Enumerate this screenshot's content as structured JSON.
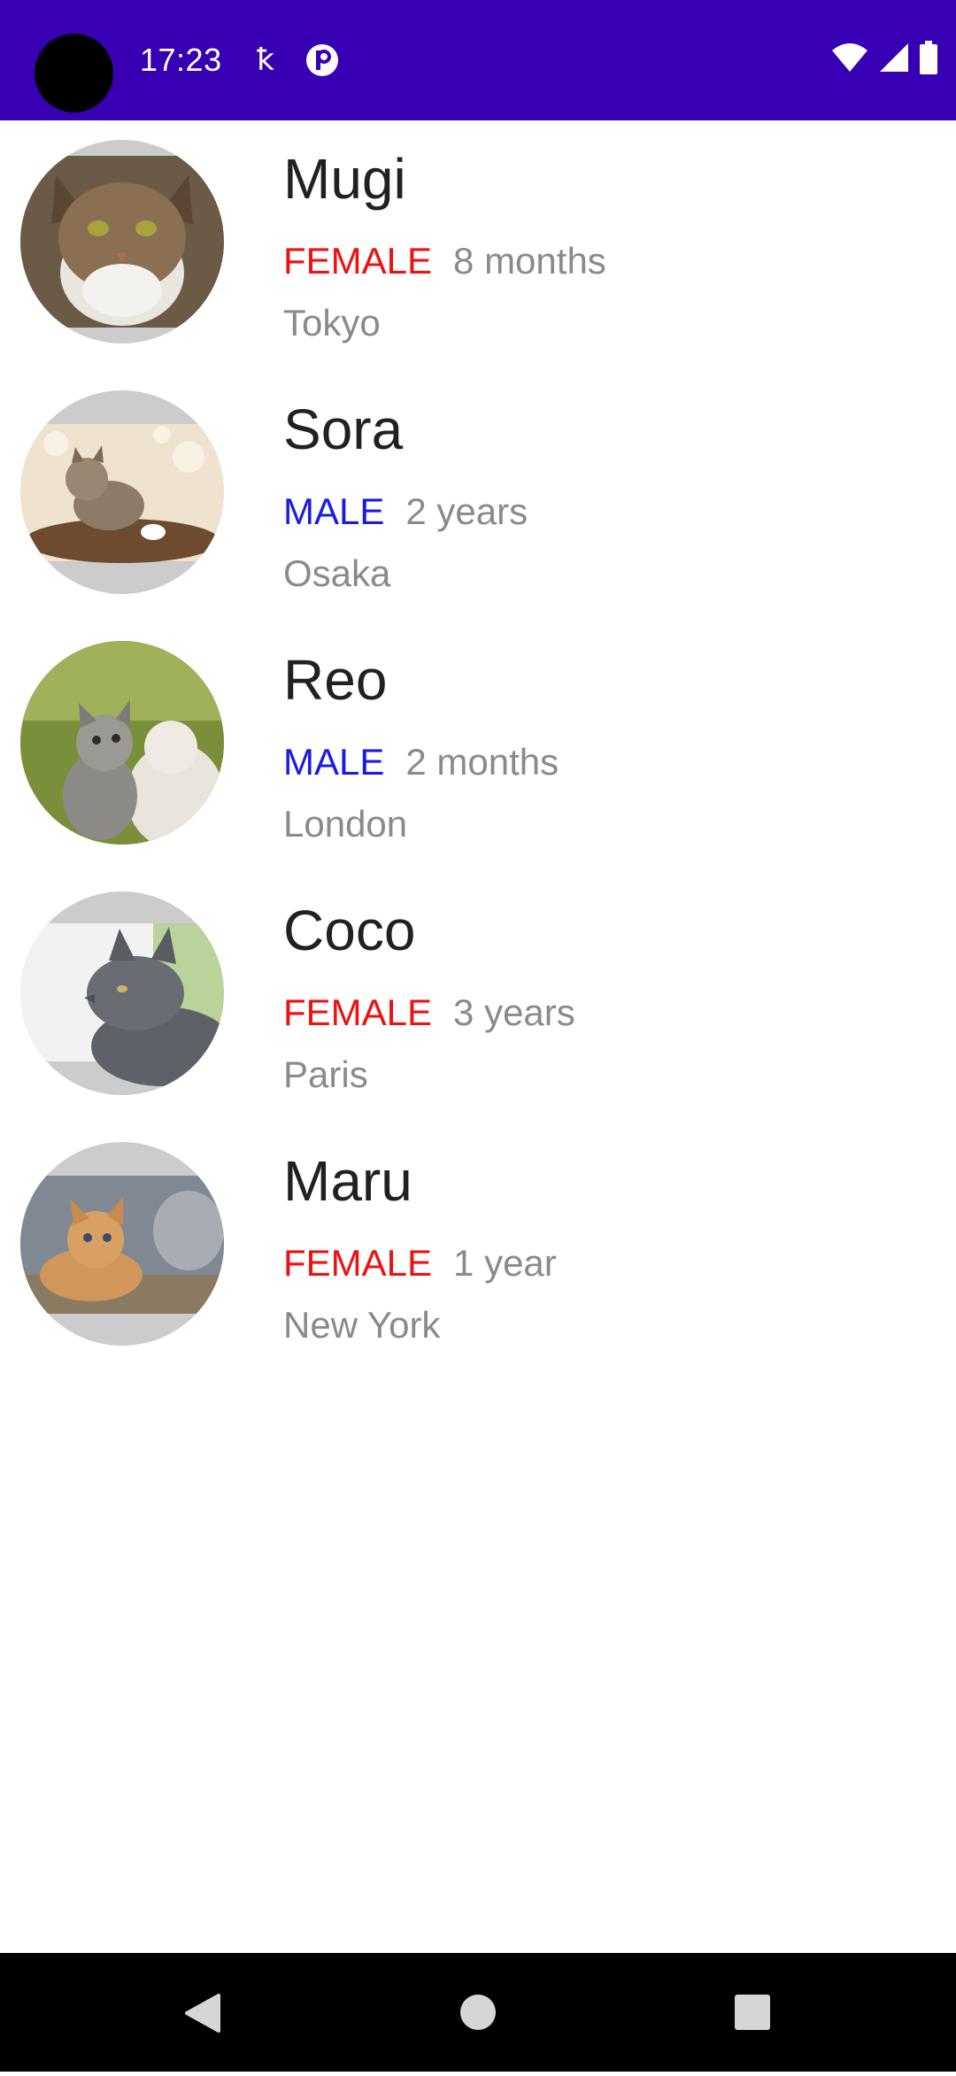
{
  "status_bar": {
    "time": "17:23",
    "icons": [
      "kotlin-icon",
      "app-notification-icon",
      "wifi-icon",
      "cellular-signal-icon",
      "battery-icon"
    ],
    "color": "#3700b3"
  },
  "cats": [
    {
      "name": "Mugi",
      "gender": "FEMALE",
      "age": "8 months",
      "city": "Tokyo"
    },
    {
      "name": "Sora",
      "gender": "MALE",
      "age": "2 years",
      "city": "Osaka"
    },
    {
      "name": "Reo",
      "gender": "MALE",
      "age": "2 months",
      "city": "London"
    },
    {
      "name": "Coco",
      "gender": "FEMALE",
      "age": "3 years",
      "city": "Paris"
    },
    {
      "name": "Maru",
      "gender": "FEMALE",
      "age": "1 year",
      "city": "New York"
    }
  ],
  "colors": {
    "female": "#ee1111",
    "male": "#1a1ae6",
    "secondary_text": "#8a8a8a",
    "primary_text": "#212121"
  },
  "nav_bar": {
    "icons": [
      "back-icon",
      "home-icon",
      "recents-icon"
    ]
  }
}
